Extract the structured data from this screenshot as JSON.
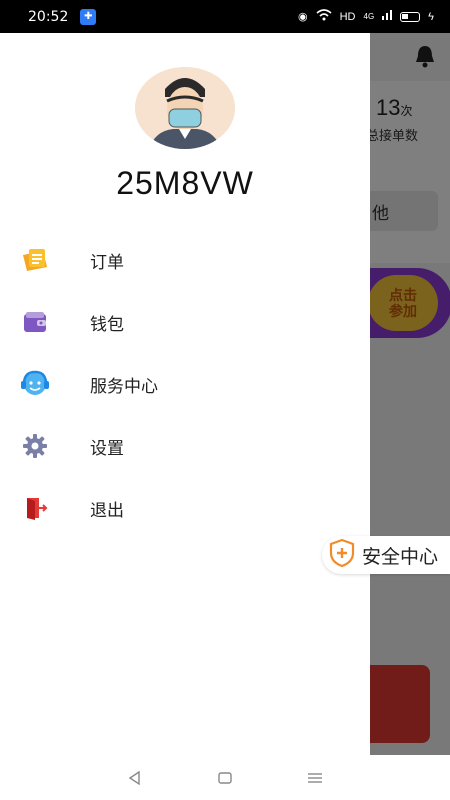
{
  "status_bar": {
    "time": "20:52",
    "network": "HD",
    "signal": "4G"
  },
  "background": {
    "count_value": "13",
    "count_unit": "次",
    "count_label": "总接单数",
    "other_button": "他",
    "join_button_line1": "点击",
    "join_button_line2": "参加"
  },
  "drawer": {
    "username": "25M8VW",
    "menu": [
      {
        "label": "订单",
        "icon": "order-notes-icon"
      },
      {
        "label": "钱包",
        "icon": "wallet-icon"
      },
      {
        "label": "服务中心",
        "icon": "customer-service-icon"
      },
      {
        "label": "设置",
        "icon": "gear-icon"
      },
      {
        "label": "退出",
        "icon": "exit-door-icon"
      }
    ]
  },
  "safety_center": {
    "label": "安全中心"
  },
  "colors": {
    "accent_purple": "#8a3ad6",
    "accent_orange": "#f28c28",
    "accent_red": "#e53935",
    "service_blue": "#3aa0e8"
  }
}
